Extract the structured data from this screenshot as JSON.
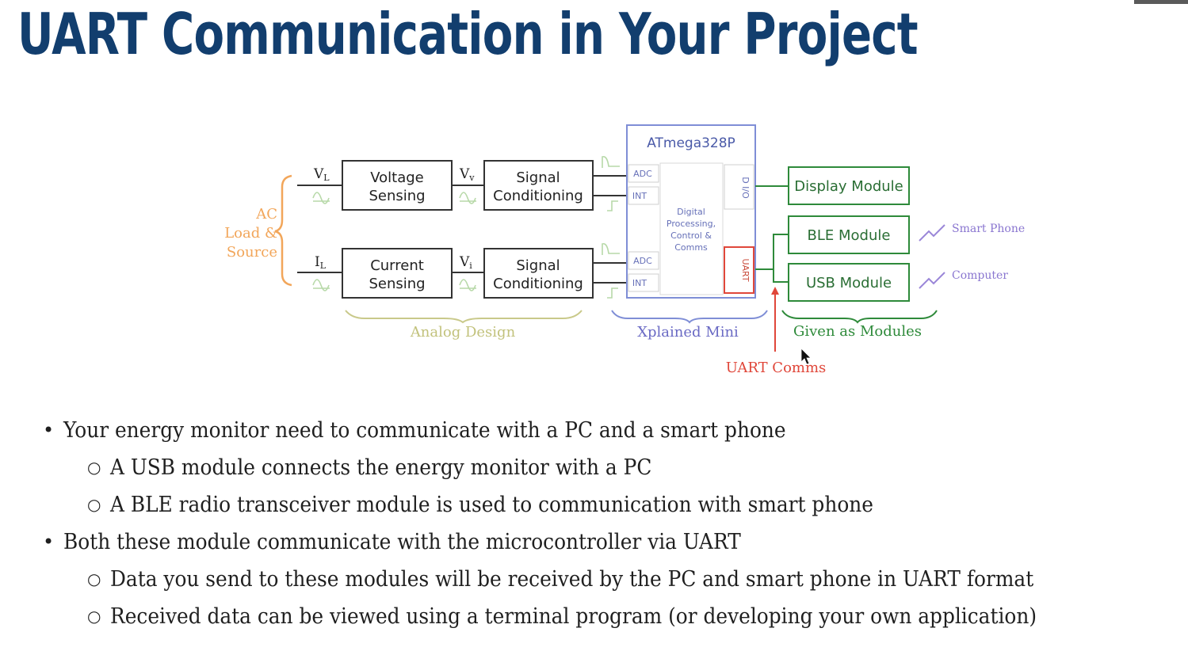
{
  "slide": {
    "title": "UART Communication in Your Project"
  },
  "diagram": {
    "source_label": [
      "AC",
      "Load &",
      "Source"
    ],
    "vl_label": "V",
    "vl_sub": "L",
    "il_label": "I",
    "il_sub": "L",
    "vv_label": "V",
    "vv_sub": "v",
    "vi_label": "V",
    "vi_sub": "i",
    "voltage_sensing": [
      "Voltage",
      "Sensing"
    ],
    "current_sensing": [
      "Current",
      "Sensing"
    ],
    "signal_conditioning": [
      "Signal",
      "Conditioning"
    ],
    "mcu_title": "ATmega328P",
    "adc_label": "ADC",
    "int_label": "INT",
    "dio_label": "D I/O",
    "uart_label": "UART",
    "core_label": [
      "Digital",
      "Processing,",
      "Control &",
      "Comms"
    ],
    "display_module": "Display Module",
    "ble_module": "BLE Module",
    "usb_module": "USB Module",
    "smart_phone": "Smart Phone",
    "computer": "Computer",
    "analog_design": "Analog Design",
    "xplained_mini": "Xplained Mini",
    "given_as_modules": "Given as Modules",
    "uart_comms": "UART Comms",
    "colors": {
      "analog": "#c9c98a",
      "mcu": "#7f8ed6",
      "modules": "#2e8a3a",
      "uart": "#e0473a",
      "source": "#f2a65a",
      "link": "#9a86d8"
    }
  },
  "bullets": [
    {
      "text": "Your energy monitor need to communicate with a PC and a smart phone",
      "subs": [
        "A USB module connects the energy monitor with a PC",
        "A BLE radio transceiver module is used to communication with smart phone"
      ]
    },
    {
      "text": "Both these module communicate with the microcontroller via UART",
      "subs": [
        "Data you send to these modules will be received by the PC and smart phone in UART format",
        "Received data can be viewed using a terminal program (or developing your own application)"
      ]
    }
  ]
}
